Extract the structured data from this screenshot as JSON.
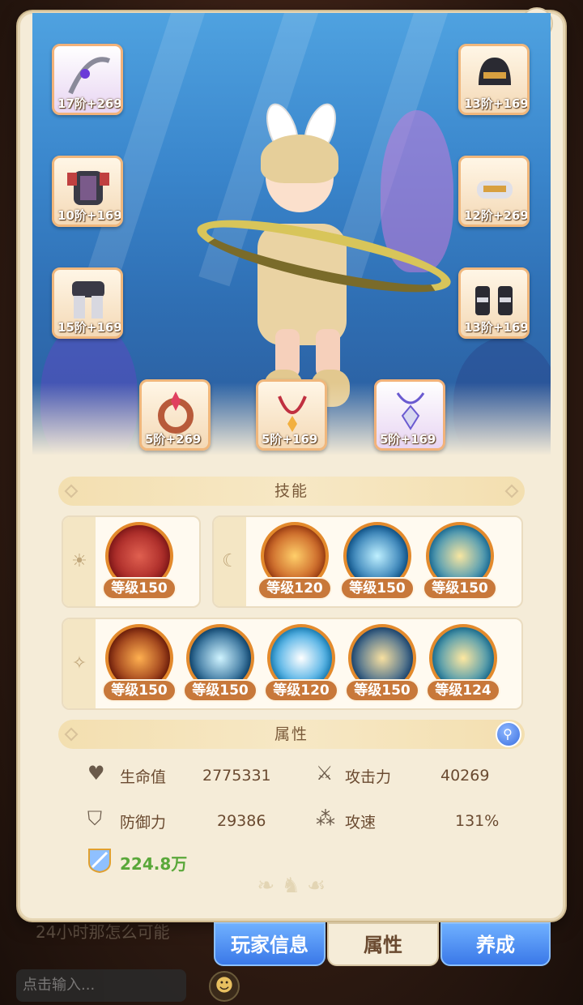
{
  "equipment": {
    "left": [
      {
        "level": "17阶",
        "plus": "+269"
      },
      {
        "level": "10阶",
        "plus": "+169"
      },
      {
        "level": "15阶",
        "plus": "+169"
      }
    ],
    "right": [
      {
        "level": "13阶",
        "plus": "+169"
      },
      {
        "level": "12阶",
        "plus": "+269"
      },
      {
        "level": "13阶",
        "plus": "+169"
      }
    ],
    "bottom": [
      {
        "level": "5阶",
        "plus": "+269"
      },
      {
        "level": "5阶",
        "plus": "+169"
      },
      {
        "level": "5阶",
        "plus": "+169"
      }
    ]
  },
  "skills": {
    "header": "技能",
    "row1_left": [
      {
        "level": "等级150"
      }
    ],
    "row1_right": [
      {
        "level": "等级120"
      },
      {
        "level": "等级150"
      },
      {
        "level": "等级150"
      }
    ],
    "row2": [
      {
        "level": "等级150"
      },
      {
        "level": "等级150"
      },
      {
        "level": "等级120"
      },
      {
        "level": "等级150"
      },
      {
        "level": "等级124"
      }
    ]
  },
  "attributes": {
    "header": "属性",
    "hp_label": "生命值",
    "hp_value": "2775331",
    "atk_label": "攻击力",
    "atk_value": "40269",
    "def_label": "防御力",
    "def_value": "29386",
    "spd_label": "攻速",
    "spd_value": "131%",
    "power_value": "224.8万"
  },
  "tabs": {
    "player_info": "玩家信息",
    "attributes": "属性",
    "develop": "养成"
  },
  "chat": {
    "last_message": "24小时那怎么可能",
    "input_placeholder": "点击输入..."
  },
  "icons": {
    "hp": "heart-icon",
    "atk": "crossed-swords-icon",
    "def": "shield-icon",
    "spd": "speed-nodes-icon",
    "power": "power-shield-icon",
    "search": "search-icon"
  }
}
